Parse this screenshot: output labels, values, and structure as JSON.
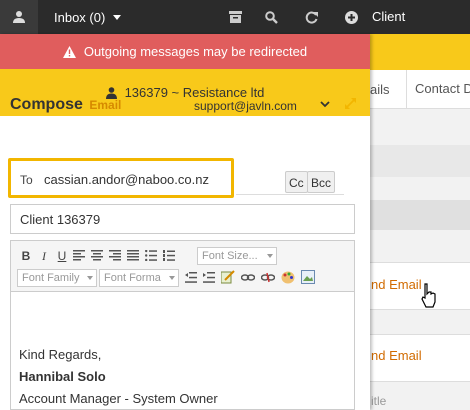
{
  "topbar": {
    "inbox_label": "Inbox (0)",
    "client_label": "Client",
    "icons": [
      "user-icon",
      "archive-icon",
      "search-icon",
      "refresh-icon",
      "add-icon"
    ]
  },
  "warning": {
    "text": "Outgoing messages may be redirected"
  },
  "client_bar": {
    "text": "136379 ~ Resistance ltd"
  },
  "compose": {
    "title": "Compose",
    "subtitle": "Email",
    "from": "support@javln.com",
    "to_label": "To",
    "to_value": "cassian.andor@naboo.co.nz",
    "cc_label": "Cc",
    "bcc_label": "Bcc",
    "subject": "Client 136379"
  },
  "editor": {
    "font_size_placeholder": "Font Size...",
    "font_family_placeholder": "Font Family",
    "font_format_placeholder": "Font Forma",
    "signature": {
      "line1": "Kind Regards,",
      "name": "Hannibal Solo",
      "role": "Account Manager - System Owner"
    }
  },
  "background_page": {
    "tab_partial": "ails",
    "tab_contact": "Contact D",
    "send_link_1": "nd Email",
    "send_link_2": "nd Email",
    "title_partial": "itle"
  },
  "colors": {
    "topbar": "#2b2b2b",
    "warning": "#e05d5d",
    "accent_yellow": "#f8c91a",
    "highlight_border": "#f2b600",
    "link_orange": "#d16b00"
  }
}
